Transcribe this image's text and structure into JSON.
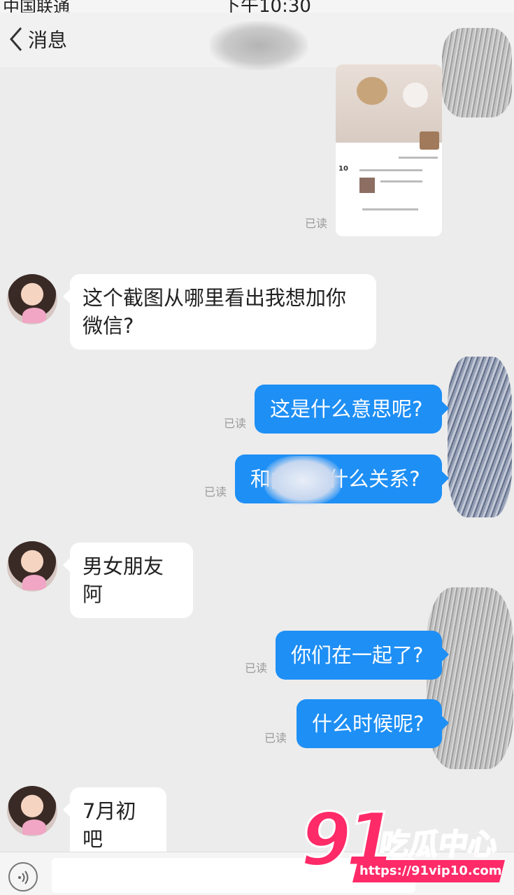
{
  "status_bar": {
    "carrier": "中国联通",
    "time": "下午10:30"
  },
  "nav": {
    "back_label": "消息"
  },
  "messages": [
    {
      "from": "them",
      "text": "这个截图从哪里看出我想加你微信?"
    },
    {
      "from": "me",
      "text": "这是什么意思呢?",
      "read": "已读"
    },
    {
      "from": "me",
      "text": "和■■■什么关系?",
      "read": "已读"
    },
    {
      "from": "them",
      "text": "男女朋友阿"
    },
    {
      "from": "me",
      "text": "你们在一起了?",
      "read": "已读"
    },
    {
      "from": "me",
      "text": "什么时候呢?",
      "read": "已读"
    },
    {
      "from": "them",
      "text": "7月初吧"
    }
  ],
  "shared_image": {
    "read": "已读",
    "counter": "10"
  },
  "watermark": {
    "logo_number": "91",
    "logo_text": "吃瓜中心",
    "url": "https://91vip10.com"
  },
  "colors": {
    "bubble_out": "#1e8ff5",
    "bubble_in": "#ffffff",
    "background": "#ececec",
    "watermark": "#ff2a68"
  }
}
